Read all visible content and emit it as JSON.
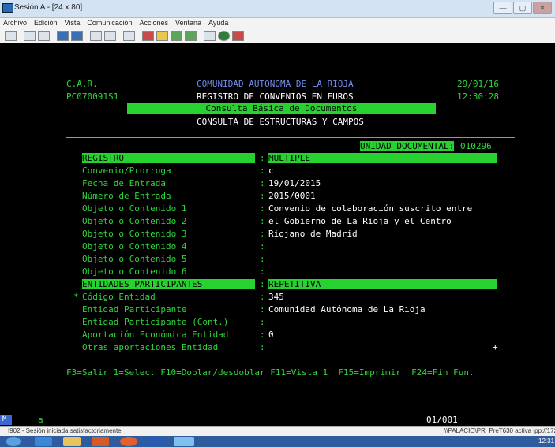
{
  "window": {
    "title": "Sesión A - [24 x 80]",
    "buttons": [
      "—",
      "▢",
      "✕"
    ]
  },
  "menu": [
    "Archivo",
    "Edición",
    "Vista",
    "Comunicación",
    "Acciones",
    "Ventana",
    "Ayuda"
  ],
  "screen": {
    "org_code": "C.A.R.",
    "program": "PC070091S1",
    "org_name": "COMUNIDAD AUTONOMA DE LA RIOJA",
    "subtitle": "REGISTRO DE CONVENIOS EN EUROS",
    "menu_title": "Consulta Básica de Documentos",
    "section_title": "CONSULTA DE ESTRUCTURAS Y CAMPOS",
    "date": "29/01/16",
    "time": "12:30:28",
    "unidad_label": "UNIDAD DOCUMENTAL:",
    "unidad_value": "010296",
    "fields": [
      {
        "label": "REGISTRO",
        "sep": ":",
        "value": "MULTIPLE",
        "header": true
      },
      {
        "label": "Convenio/Prorroga",
        "sep": ":",
        "value": "c"
      },
      {
        "label": "Fecha de Entrada",
        "sep": ":",
        "value": "19/01/2015"
      },
      {
        "label": "Número de Entrada",
        "sep": ":",
        "value": "2015/0001"
      },
      {
        "label": "Objeto o Contenido 1",
        "sep": ":",
        "value": "Convenio de colaboración suscrito entre"
      },
      {
        "label": "Objeto o Contenido 2",
        "sep": ":",
        "value": "el Gobierno de La Rioja y el Centro"
      },
      {
        "label": "Objeto o Contenido 3",
        "sep": ":",
        "value": "Riojano de Madrid"
      },
      {
        "label": "Objeto o Contenido 4",
        "sep": ":",
        "value": ""
      },
      {
        "label": "Objeto o Contenido 5",
        "sep": ":",
        "value": ""
      },
      {
        "label": "Objeto o Contenido 6",
        "sep": ":",
        "value": ""
      },
      {
        "label": "ENTIDADES PARTICIPANTES",
        "sep": ":",
        "value": "REPETITIVA",
        "header": true
      },
      {
        "label": "Código Entidad",
        "sep": ":",
        "value": "345",
        "marker": "*"
      },
      {
        "label": "Entidad Participante",
        "sep": ":",
        "value": "Comunidad Autónoma de La Rioja"
      },
      {
        "label": "Entidad Participante (Cont.)",
        "sep": ":",
        "value": ""
      },
      {
        "label": "Aportación Económica Entidad",
        "sep": ":",
        "value": "0"
      },
      {
        "label": "Otras aportaciones Entidad",
        "sep": ":",
        "value": "",
        "more": "+"
      }
    ],
    "function_keys": "F3=Salir 1=Selec. F10=Doblar/desdoblar F11=Vista 1  F15=Imprimir  F24=Fin Fun.",
    "oia_mode": "M",
    "oia_input": "a",
    "oia_pos": "01/001"
  },
  "statusbar": {
    "left": "I902 - Sesión iniciada satisfactoriamente",
    "right": "\\\\PALACIO\\PR_PreT630 activa ipp://172.1"
  },
  "taskbar": {
    "clock": "12:31"
  }
}
